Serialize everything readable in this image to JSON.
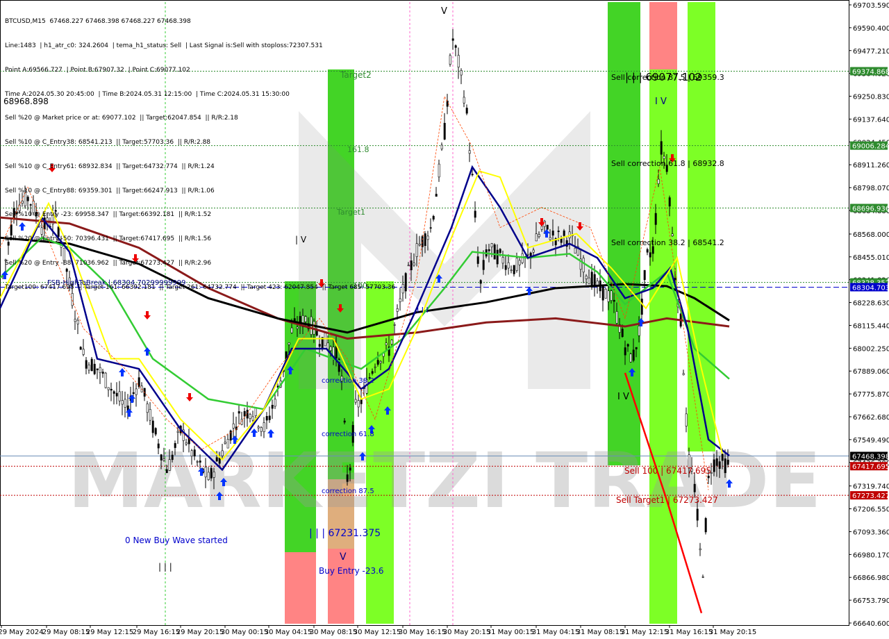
{
  "header": {
    "symbol_line": "BTCUSD,M15  67468.227 67468.398 67468.227 67468.398",
    "lines": [
      "Line:1483  | h1_atr_c0: 324.2604  | tema_h1_status: Sell  | Last Signal is:Sell with stoploss:72307.531",
      "Point A:69566.727  | Point B:67907.32  | Point C:69077.102",
      "Time A:2024.05.30 20:45:00  | Time B:2024.05.31 12:15:00  | Time C:2024.05.31 15:30:00",
      "Sell %20 @ Market price or at: 69077.102  || Target:62047.854  || R/R:2.18",
      "Sell %10 @ C_Entry38: 68541.213  || Target:57703.36  || R/R:2.88",
      "Sell %10 @ C_Entry61: 68932.834  || Target:64732.774  || R/R:1.24",
      "Sell %10 @ C_Entry88: 69359.301  || Target:66247.913  || R/R:1.06",
      "Sell %10 @ Entry -23: 69958.347  || Target:66392.181  || R/R:1.52",
      "Sell %20 @ Entry -50: 70396.431  || Target:67417.695  || R/R:1.56",
      "Sell %20 @ Entry -88: 71036.962  || Target:67273.427  || R/R:2.96",
      "Target100: 67417.695  || Target 161: 66392.181  || Target 261: 64732.774  || Target 423: 62047.854  || Target 685: 57703.36"
    ],
    "overlap_label": "68968.898"
  },
  "watermark": "MARKETZI TRADE",
  "colors": {
    "bg": "#ffffff",
    "grid_green": "#2e8b2e",
    "red_dotted": "#8b0000",
    "blue_dashed": "#0000cc",
    "green_zone": "#22cc00",
    "lime_zone": "#66ff00",
    "salmon_zone": "#ff6e6e",
    "orange_zone": "#d9a066",
    "ma_black": "#000000",
    "ma_brown": "#8b1a1a",
    "ma_green": "#33cc33",
    "ma_blue": "#00008b",
    "ma_yellow": "#ffff00"
  },
  "chart_data": {
    "type": "candlestick",
    "title": "BTCUSD,M15",
    "y_ticks": [
      "69703.590",
      "69590.400",
      "69477.210",
      "69364.020",
      "69250.830",
      "69137.640",
      "69024.450",
      "68911.260",
      "68798.070",
      "68684.880",
      "68568.000",
      "68455.010",
      "68341.820",
      "68228.630",
      "68115.440",
      "68002.250",
      "67889.060",
      "67775.870",
      "67662.680",
      "67549.490",
      "67436.300",
      "67319.740",
      "67206.550",
      "67093.360",
      "66980.170",
      "66866.980",
      "66753.790",
      "66640.600"
    ],
    "x_ticks": [
      "29 May 2024",
      "29 May 08:15",
      "29 May 12:15",
      "29 May 16:15",
      "29 May 20:15",
      "30 May 00:15",
      "30 May 04:15",
      "30 May 08:15",
      "30 May 12:15",
      "30 May 16:15",
      "30 May 20:15",
      "31 May 00:15",
      "31 May 04:15",
      "31 May 08:15",
      "31 May 12:15",
      "31 May 16:15",
      "31 May 20:15"
    ],
    "ylim": [
      66640.6,
      69703.59
    ],
    "price_tags": [
      {
        "label": "69374.868",
        "value": 69374.868,
        "color": "#2e8b2e"
      },
      {
        "label": "69006.284",
        "value": 69006.284,
        "color": "#2e8b2e"
      },
      {
        "label": "68696.936",
        "value": 68696.936,
        "color": "#2e8b2e"
      },
      {
        "label": "68328.352",
        "value": 68328.352,
        "color": "#2e8b2e"
      },
      {
        "label": "68304.703",
        "value": 68304.703,
        "color": "#0000cc"
      },
      {
        "label": "67468.398",
        "value": 67468.398,
        "color": "#000000"
      },
      {
        "label": "67417.695",
        "value": 67417.695,
        "color": "#c00000"
      },
      {
        "label": "67273.427",
        "value": 67273.427,
        "color": "#c00000"
      }
    ],
    "annotations": [
      {
        "text": "Target2",
        "color": "#2e8b2e"
      },
      {
        "text": "161.8",
        "color": "#2e8b2e"
      },
      {
        "text": "Target1",
        "color": "#2e8b2e"
      },
      {
        "text": "100",
        "color": "#2e8b2e"
      },
      {
        "text": "FSB-HighToBreak | 68304.70299999999",
        "color": "#000080"
      },
      {
        "text": "correction 38.2",
        "color": "#0000cc"
      },
      {
        "text": "correction 61.8",
        "color": "#0000cc"
      },
      {
        "text": "correction 87.5",
        "color": "#0000cc"
      },
      {
        "text": "| | | 67231.375",
        "color": "#0000cc"
      },
      {
        "text": "Buy Entry -23.6",
        "color": "#0000cc"
      },
      {
        "text": "0 New Buy Wave started",
        "color": "#0000cc"
      },
      {
        "text": "Sell correction 87.5 | 69359.3",
        "color": "#000000"
      },
      {
        "text": "| | | 69077.102",
        "color": "#000000"
      },
      {
        "text": "Sell correction 61.8 | 68932.8",
        "color": "#000000"
      },
      {
        "text": "Sell correction 38.2 | 68541.2",
        "color": "#000000"
      },
      {
        "text": "Sell 100 | 67417.695",
        "color": "#c00000"
      },
      {
        "text": "Sell Target1 | 67273.427",
        "color": "#c00000"
      },
      {
        "text": "| | |",
        "color": "#000000"
      },
      {
        "text": "| V",
        "color": "#000000"
      },
      {
        "text": "I V",
        "color": "#000000"
      },
      {
        "text": "I V",
        "color": "#000080"
      },
      {
        "text": "V",
        "color": "#000080"
      },
      {
        "text": "V",
        "color": "#000000"
      },
      {
        "text": "I I I",
        "color": "#0000cc"
      }
    ]
  }
}
